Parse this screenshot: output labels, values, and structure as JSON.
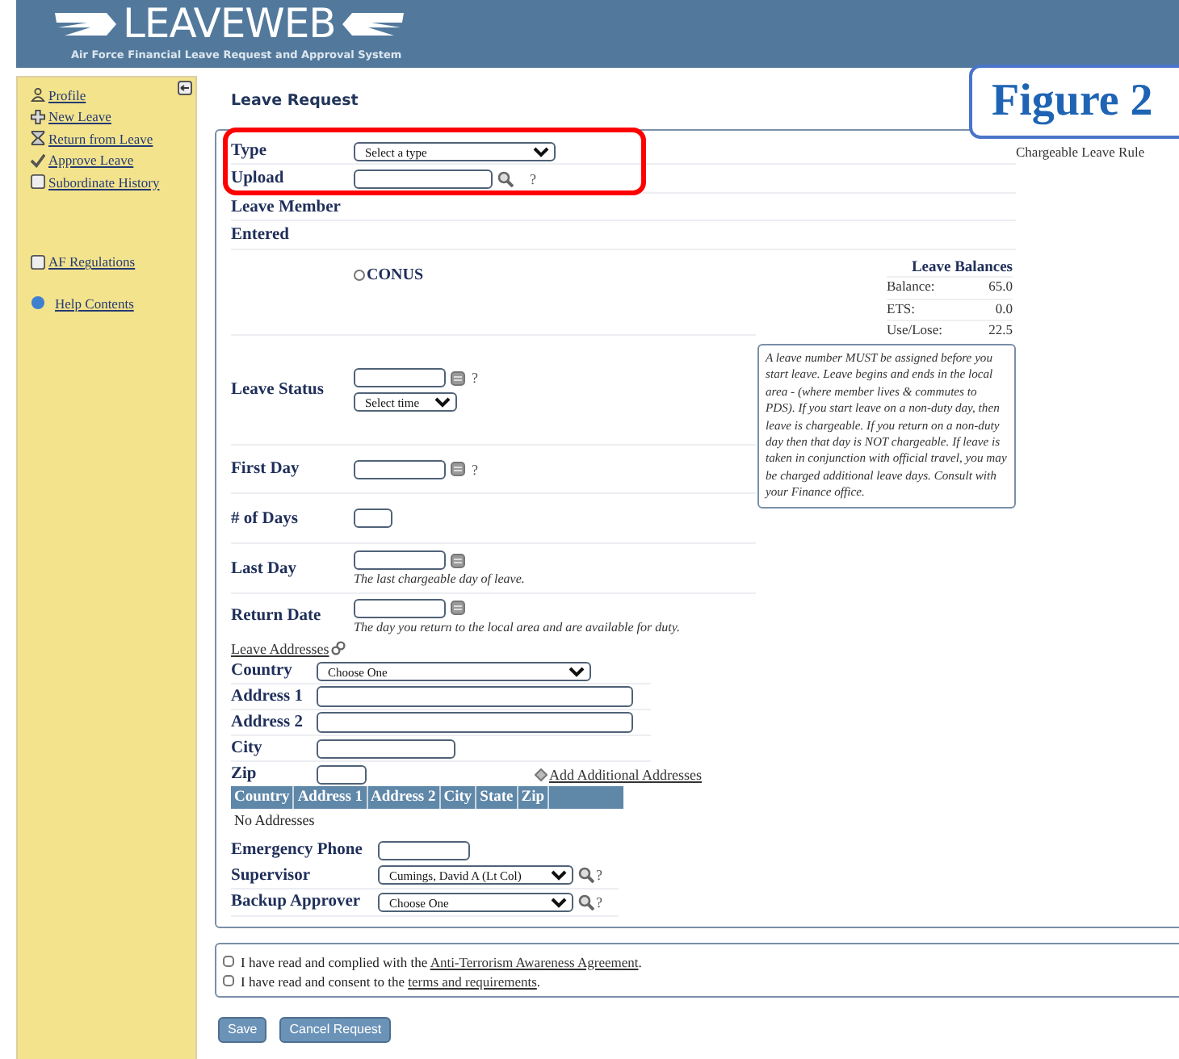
{
  "header": {
    "logo": "LEAVEWEB",
    "subtitle": "Air Force Financial Leave Request and Approval System"
  },
  "sidebar": {
    "items": [
      {
        "label": "Profile",
        "kind": "person"
      },
      {
        "label": "New Leave",
        "kind": "plus"
      },
      {
        "label": "Return from Leave",
        "kind": "hourglass"
      },
      {
        "label": "Approve Leave",
        "kind": "check"
      },
      {
        "label": "Subordinate History",
        "kind": "doc"
      }
    ],
    "links": [
      {
        "label": "AF Regulations",
        "kind": "doc"
      },
      {
        "label": "Help Contents",
        "kind": "help"
      }
    ]
  },
  "page_title": "Leave Request",
  "figure_label": "Figure 2",
  "rules_link": "Chargeable Leave Rule",
  "type": {
    "label": "Type",
    "value": "Select a type"
  },
  "upload": {
    "label": "Upload",
    "help": "?"
  },
  "member": {
    "label": "Leave Member"
  },
  "entered": {
    "label": "Entered"
  },
  "location": {
    "options": [
      {
        "label": "CONUS",
        "selected": false
      }
    ]
  },
  "balances": {
    "title": "Leave Balances",
    "rows": [
      {
        "label": "Balance:",
        "value": "65.0"
      },
      {
        "label": "ETS:",
        "value": "0.0"
      },
      {
        "label": "Use/Lose:",
        "value": "22.5"
      }
    ]
  },
  "leave_status": {
    "label": "Leave Status",
    "time": "Select time",
    "help": "?"
  },
  "first_day": {
    "label": "First Day",
    "help": "?"
  },
  "days": {
    "label": "# of Days"
  },
  "last_day": {
    "label": "Last Day",
    "hint": "The last chargeable day of leave."
  },
  "return_date": {
    "label": "Return Date",
    "hint": "The day you return to the local area and are available for duty."
  },
  "note": "A leave number MUST be assigned before you start leave. Leave begins and ends in the local area - (where member lives & commutes to PDS). If you start leave on a non-duty day, then leave is chargeable. If you return on a non-duty day then that day is NOT chargeable. If leave is taken in conjunction with official travel, you may be charged additional leave days. Consult with your Finance office.",
  "addresses": {
    "link": "Leave Addresses",
    "country": {
      "label": "Country",
      "value": "Choose One"
    },
    "address1": "Address 1",
    "address2": "Address 2",
    "city": "City",
    "zip": "Zip",
    "add_link": "Add Additional Addresses",
    "columns": [
      "Country",
      "Address 1",
      "Address 2",
      "City",
      "State",
      "Zip"
    ],
    "empty": "No Addresses"
  },
  "emergency_phone": {
    "label": "Emergency Phone"
  },
  "supervisor": {
    "label": "Supervisor",
    "value": "Cumings, David A (Lt Col)",
    "help": "?"
  },
  "backup": {
    "label": "Backup Approver",
    "value": "Choose One",
    "help": "?"
  },
  "agreements": [
    {
      "before": "I have read and complied with the ",
      "link": "Anti-Terrorism Awareness Agreement",
      "after": ".",
      "checked": false
    },
    {
      "before": "I have read and consent to the ",
      "link": "terms and requirements",
      "after": ".",
      "checked": false
    }
  ],
  "buttons": [
    "Save",
    "Cancel Request"
  ]
}
